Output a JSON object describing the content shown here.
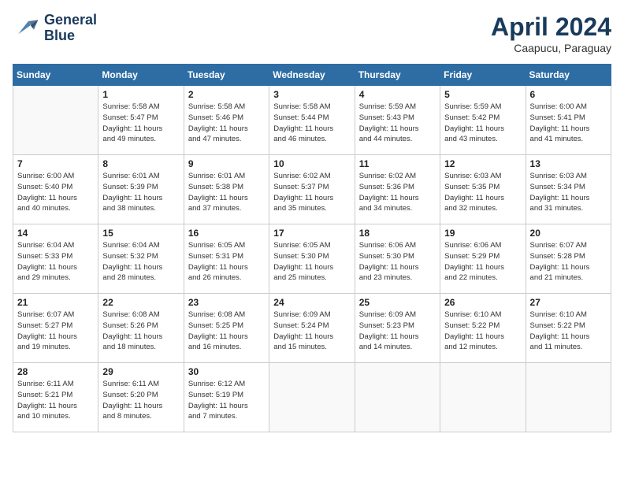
{
  "header": {
    "logo_line1": "General",
    "logo_line2": "Blue",
    "month_title": "April 2024",
    "location": "Caapucu, Paraguay"
  },
  "weekdays": [
    "Sunday",
    "Monday",
    "Tuesday",
    "Wednesday",
    "Thursday",
    "Friday",
    "Saturday"
  ],
  "weeks": [
    [
      {
        "day": "",
        "info": ""
      },
      {
        "day": "1",
        "info": "Sunrise: 5:58 AM\nSunset: 5:47 PM\nDaylight: 11 hours\nand 49 minutes."
      },
      {
        "day": "2",
        "info": "Sunrise: 5:58 AM\nSunset: 5:46 PM\nDaylight: 11 hours\nand 47 minutes."
      },
      {
        "day": "3",
        "info": "Sunrise: 5:58 AM\nSunset: 5:44 PM\nDaylight: 11 hours\nand 46 minutes."
      },
      {
        "day": "4",
        "info": "Sunrise: 5:59 AM\nSunset: 5:43 PM\nDaylight: 11 hours\nand 44 minutes."
      },
      {
        "day": "5",
        "info": "Sunrise: 5:59 AM\nSunset: 5:42 PM\nDaylight: 11 hours\nand 43 minutes."
      },
      {
        "day": "6",
        "info": "Sunrise: 6:00 AM\nSunset: 5:41 PM\nDaylight: 11 hours\nand 41 minutes."
      }
    ],
    [
      {
        "day": "7",
        "info": "Sunrise: 6:00 AM\nSunset: 5:40 PM\nDaylight: 11 hours\nand 40 minutes."
      },
      {
        "day": "8",
        "info": "Sunrise: 6:01 AM\nSunset: 5:39 PM\nDaylight: 11 hours\nand 38 minutes."
      },
      {
        "day": "9",
        "info": "Sunrise: 6:01 AM\nSunset: 5:38 PM\nDaylight: 11 hours\nand 37 minutes."
      },
      {
        "day": "10",
        "info": "Sunrise: 6:02 AM\nSunset: 5:37 PM\nDaylight: 11 hours\nand 35 minutes."
      },
      {
        "day": "11",
        "info": "Sunrise: 6:02 AM\nSunset: 5:36 PM\nDaylight: 11 hours\nand 34 minutes."
      },
      {
        "day": "12",
        "info": "Sunrise: 6:03 AM\nSunset: 5:35 PM\nDaylight: 11 hours\nand 32 minutes."
      },
      {
        "day": "13",
        "info": "Sunrise: 6:03 AM\nSunset: 5:34 PM\nDaylight: 11 hours\nand 31 minutes."
      }
    ],
    [
      {
        "day": "14",
        "info": "Sunrise: 6:04 AM\nSunset: 5:33 PM\nDaylight: 11 hours\nand 29 minutes."
      },
      {
        "day": "15",
        "info": "Sunrise: 6:04 AM\nSunset: 5:32 PM\nDaylight: 11 hours\nand 28 minutes."
      },
      {
        "day": "16",
        "info": "Sunrise: 6:05 AM\nSunset: 5:31 PM\nDaylight: 11 hours\nand 26 minutes."
      },
      {
        "day": "17",
        "info": "Sunrise: 6:05 AM\nSunset: 5:30 PM\nDaylight: 11 hours\nand 25 minutes."
      },
      {
        "day": "18",
        "info": "Sunrise: 6:06 AM\nSunset: 5:30 PM\nDaylight: 11 hours\nand 23 minutes."
      },
      {
        "day": "19",
        "info": "Sunrise: 6:06 AM\nSunset: 5:29 PM\nDaylight: 11 hours\nand 22 minutes."
      },
      {
        "day": "20",
        "info": "Sunrise: 6:07 AM\nSunset: 5:28 PM\nDaylight: 11 hours\nand 21 minutes."
      }
    ],
    [
      {
        "day": "21",
        "info": "Sunrise: 6:07 AM\nSunset: 5:27 PM\nDaylight: 11 hours\nand 19 minutes."
      },
      {
        "day": "22",
        "info": "Sunrise: 6:08 AM\nSunset: 5:26 PM\nDaylight: 11 hours\nand 18 minutes."
      },
      {
        "day": "23",
        "info": "Sunrise: 6:08 AM\nSunset: 5:25 PM\nDaylight: 11 hours\nand 16 minutes."
      },
      {
        "day": "24",
        "info": "Sunrise: 6:09 AM\nSunset: 5:24 PM\nDaylight: 11 hours\nand 15 minutes."
      },
      {
        "day": "25",
        "info": "Sunrise: 6:09 AM\nSunset: 5:23 PM\nDaylight: 11 hours\nand 14 minutes."
      },
      {
        "day": "26",
        "info": "Sunrise: 6:10 AM\nSunset: 5:22 PM\nDaylight: 11 hours\nand 12 minutes."
      },
      {
        "day": "27",
        "info": "Sunrise: 6:10 AM\nSunset: 5:22 PM\nDaylight: 11 hours\nand 11 minutes."
      }
    ],
    [
      {
        "day": "28",
        "info": "Sunrise: 6:11 AM\nSunset: 5:21 PM\nDaylight: 11 hours\nand 10 minutes."
      },
      {
        "day": "29",
        "info": "Sunrise: 6:11 AM\nSunset: 5:20 PM\nDaylight: 11 hours\nand 8 minutes."
      },
      {
        "day": "30",
        "info": "Sunrise: 6:12 AM\nSunset: 5:19 PM\nDaylight: 11 hours\nand 7 minutes."
      },
      {
        "day": "",
        "info": ""
      },
      {
        "day": "",
        "info": ""
      },
      {
        "day": "",
        "info": ""
      },
      {
        "day": "",
        "info": ""
      }
    ]
  ]
}
